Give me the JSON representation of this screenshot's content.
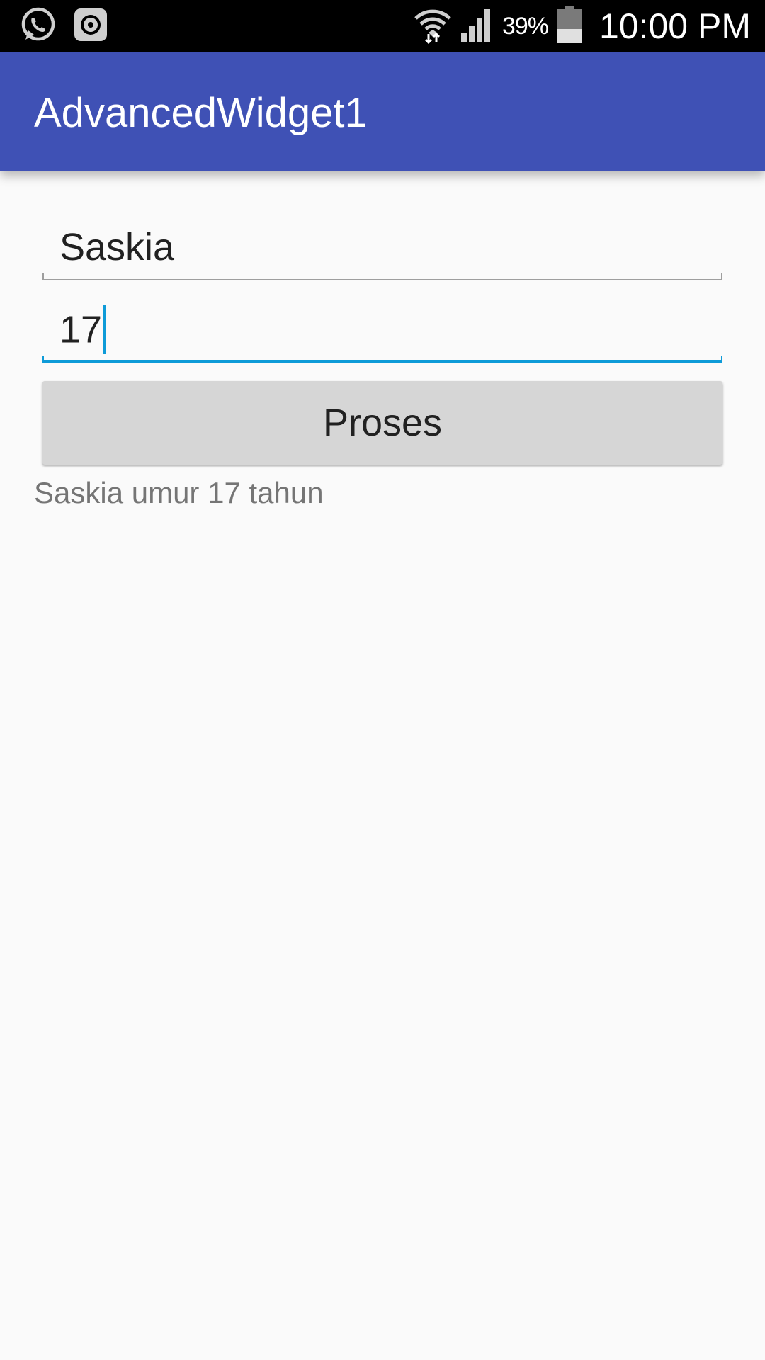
{
  "status_bar": {
    "battery_percent": "39%",
    "time": "10:00 PM",
    "icons": [
      "whatsapp-icon",
      "music-app-icon",
      "wifi-icon",
      "signal-icon",
      "battery-icon"
    ]
  },
  "app_bar": {
    "title": "AdvancedWidget1",
    "color": "#3f51b5"
  },
  "form": {
    "name_value": "Saskia",
    "age_value": "17",
    "button_label": "Proses",
    "result": "Saskia umur 17 tahun"
  },
  "colors": {
    "accent": "#0e9bd8",
    "status_bar": "#000000",
    "button": "#d6d6d6"
  }
}
